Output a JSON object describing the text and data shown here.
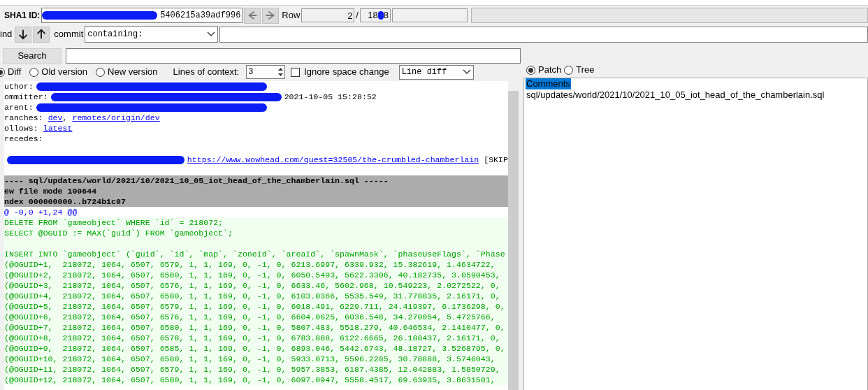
{
  "toolbar": {
    "sha1_label": "SHA1 ID:",
    "sha1_value": "5406215a39adf996",
    "row_label": "Row",
    "row_current": "2",
    "row_separator": "/",
    "row_total_start": "18",
    "row_total_end": "8"
  },
  "find": {
    "label": "ind",
    "commit_label": "commit",
    "mode": "containing:"
  },
  "search": {
    "button": "Search"
  },
  "diff_options": {
    "modes": [
      {
        "label": "Diff",
        "selected": true
      },
      {
        "label": "Old version",
        "selected": false
      },
      {
        "label": "New version",
        "selected": false
      }
    ],
    "context_label": "Lines of context:",
    "context_value": "3",
    "ignore_space": {
      "label": "Ignore space change",
      "checked": false
    },
    "diff_style": "Line diff"
  },
  "view_options": [
    {
      "label": "Patch",
      "selected": true
    },
    {
      "label": "Tree",
      "selected": false
    }
  ],
  "diff_lines": [
    {
      "kind": "header",
      "segments": [
        {
          "kind": "text",
          "text": "uthor:"
        },
        {
          "kind": "redaction"
        }
      ]
    },
    {
      "kind": "header",
      "segments": [
        {
          "kind": "text",
          "text": "ommitter:"
        },
        {
          "kind": "redaction"
        },
        {
          "kind": "text",
          "text": "2021-10-05 15:28:52"
        }
      ]
    },
    {
      "kind": "header",
      "segments": [
        {
          "kind": "text",
          "text": "arent:"
        },
        {
          "kind": "redaction"
        }
      ]
    },
    {
      "kind": "header",
      "segments": [
        {
          "kind": "text",
          "text": "ranches: "
        },
        {
          "kind": "link",
          "text": "dev"
        },
        {
          "kind": "text",
          "text": ", "
        },
        {
          "kind": "link",
          "text": "remotes/origin/dev"
        }
      ]
    },
    {
      "kind": "header",
      "segments": [
        {
          "kind": "text",
          "text": "ollows: "
        },
        {
          "kind": "link",
          "text": "latest"
        }
      ]
    },
    {
      "kind": "header",
      "segments": [
        {
          "kind": "text",
          "text": "recedes:"
        }
      ]
    },
    {
      "kind": "blank"
    },
    {
      "kind": "header",
      "segments": [
        {
          "kind": "redaction"
        },
        {
          "kind": "link",
          "text": "https://www.wowhead.com/quest=32505/the-crumbled-chamberlain"
        },
        {
          "kind": "text",
          "text": " [SKIP"
        }
      ]
    },
    {
      "kind": "blank"
    },
    {
      "kind": "filehead",
      "text": "---- sql/updates/world/2021/10/2021_10_05_iot_head_of_the_chamberlain.sql -----"
    },
    {
      "kind": "filehead",
      "text": "ew file mode 100644"
    },
    {
      "kind": "filehead",
      "text": "ndex 000000000..b724b1c07"
    },
    {
      "kind": "hunk",
      "text": "@ -0,0 +1,24 @@"
    },
    {
      "kind": "add",
      "text": "DELETE FROM `gameobject` WHERE `id` = 218072;"
    },
    {
      "kind": "add",
      "text": "SELECT @OGUID := MAX(`guid`) FROM `gameobject`;"
    },
    {
      "kind": "add_blank"
    },
    {
      "kind": "add",
      "text": "INSERT INTO `gameobject` (`guid`, `id`, `map`, `zoneId`, `areaId`, `spawnMask`, `phaseUseFlags`, `Phase"
    },
    {
      "kind": "add",
      "text": "(@OGUID+1,  218072, 1064, 6507, 6579, 1, 1, 169, 0, -1, 0, 6213.6997, 6339.932, 15.382619, 1.4634722,"
    },
    {
      "kind": "add",
      "text": "(@OGUID+2,  218072, 1064, 6507, 6580, 1, 1, 169, 0, -1, 0, 6050.5493, 5622.3306, 40.182735, 3.0590453,"
    },
    {
      "kind": "add",
      "text": "(@OGUID+3,  218072, 1064, 6507, 6576, 1, 1, 169, 0, -1, 0, 6633.46, 5602.968, 10.549223, 2.0272522, 0,"
    },
    {
      "kind": "add",
      "text": "(@OGUID+4,  218072, 1064, 6507, 6580, 1, 1, 169, 0, -1, 0, 6103.0366, 5535.549, 31.778835, 2.16171, 0,"
    },
    {
      "kind": "add",
      "text": "(@OGUID+5,  218072, 1064, 6507, 6579, 1, 1, 169, 0, -1, 0, 6018.491, 6229.711, 24.419397, 6.1736298, 0,"
    },
    {
      "kind": "add",
      "text": "(@OGUID+6,  218072, 1064, 6507, 6576, 1, 1, 169, 0, -1, 0, 6604.0625, 6036.548, 34.270054, 5.4725766,"
    },
    {
      "kind": "add",
      "text": "(@OGUID+7,  218072, 1064, 6507, 6580, 1, 1, 169, 0, -1, 0, 5807.483, 5518.279, 40.646534, 2.1410477, 0,"
    },
    {
      "kind": "add",
      "text": "(@OGUID+8,  218072, 1064, 6507, 6578, 1, 1, 169, 0, -1, 0, 6783.888, 6122.6665, 26.188437, 2.16171, 0,"
    },
    {
      "kind": "add",
      "text": "(@OGUID+9,  218072, 1064, 6507, 6585, 1, 1, 169, 0, -1, 0, 6893.046, 5442.6743, 48.18727, 3.5268795, 0,"
    },
    {
      "kind": "add",
      "text": "(@OGUID+10, 218072, 1064, 6507, 6580, 1, 1, 169, 0, -1, 0, 5933.0713, 5596.2285, 30.78888, 3.5746043,"
    },
    {
      "kind": "add",
      "text": "(@OGUID+11, 218072, 1064, 6507, 6579, 1, 1, 169, 0, -1, 0, 5957.3853, 6187.4385, 12.042883, 1.5850729,"
    },
    {
      "kind": "add",
      "text": "(@OGUID+12, 218072, 1064, 6507, 6580, 1, 1, 169, 0, -1, 0, 6097.0947, 5558.4517, 69.63935, 3.8631501,"
    }
  ],
  "files": [
    {
      "label": "Comments",
      "selected": true
    },
    {
      "label": "sql/updates/world/2021/10/2021_10_05_iot_head_of_the_chamberlain.sql",
      "selected": false
    }
  ]
}
